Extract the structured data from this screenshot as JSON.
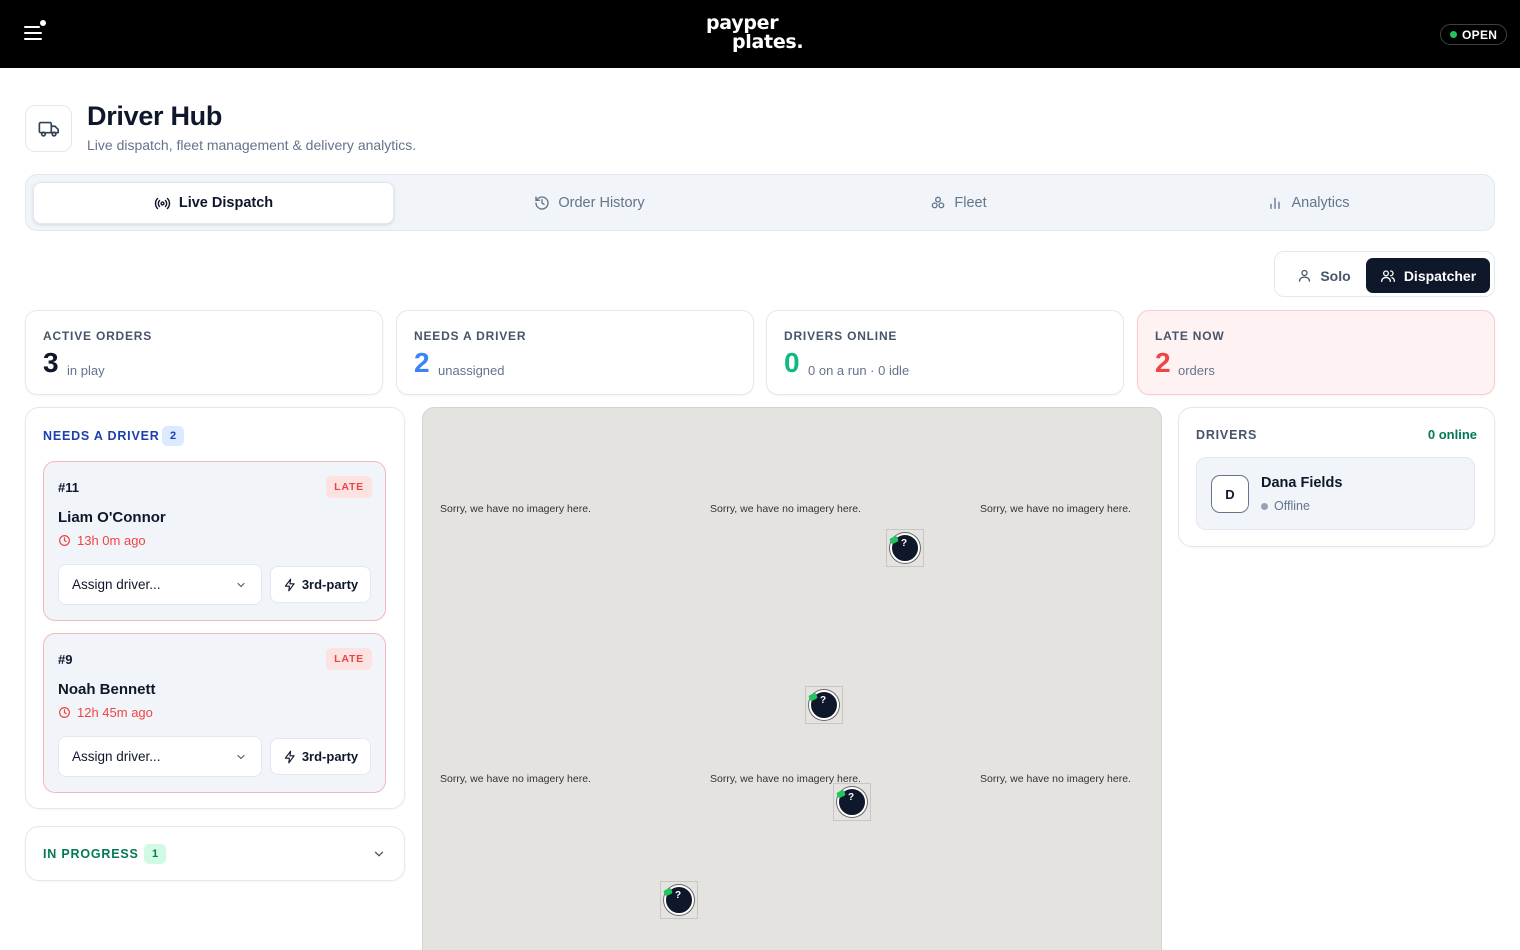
{
  "topbar": {
    "logo_line1": "payper",
    "logo_line2": "plates.",
    "status_label": "OPEN",
    "status_color": "#22c55e"
  },
  "header": {
    "title": "Driver Hub",
    "subtitle": "Live dispatch, fleet management & delivery analytics."
  },
  "tabs": [
    {
      "label": "Live Dispatch",
      "icon": "broadcast-icon",
      "active": true
    },
    {
      "label": "Order History",
      "icon": "history-icon",
      "active": false
    },
    {
      "label": "Fleet",
      "icon": "fleet-icon",
      "active": false
    },
    {
      "label": "Analytics",
      "icon": "bar-chart-icon",
      "active": false
    }
  ],
  "mode": {
    "solo_label": "Solo",
    "dispatcher_label": "Dispatcher",
    "selected": "Dispatcher"
  },
  "stats": [
    {
      "label": "ACTIVE ORDERS",
      "value": "3",
      "unit": "in play",
      "color": "#0f172a"
    },
    {
      "label": "NEEDS A DRIVER",
      "value": "2",
      "unit": "unassigned",
      "color": "#3b82f6"
    },
    {
      "label": "DRIVERS ONLINE",
      "value": "0",
      "unit": "0 on a run · 0 idle",
      "color": "#10b981"
    },
    {
      "label": "LATE NOW",
      "value": "2",
      "unit": "orders",
      "color": "#ef4444"
    }
  ],
  "needs_driver": {
    "title": "NEEDS A DRIVER",
    "count": "2",
    "orders": [
      {
        "id": "#11",
        "badge": "LATE",
        "name": "Liam O'Connor",
        "age": "13h 0m ago",
        "assign_placeholder": "Assign driver...",
        "third_party_label": "3rd-party"
      },
      {
        "id": "#9",
        "badge": "LATE",
        "name": "Noah Bennett",
        "age": "12h 45m ago",
        "assign_placeholder": "Assign driver...",
        "third_party_label": "3rd-party"
      }
    ]
  },
  "in_progress": {
    "title": "IN PROGRESS",
    "count": "1"
  },
  "map": {
    "no_imagery_text": "Sorry, we have no imagery here.",
    "marker_glyph": "?"
  },
  "drivers": {
    "title": "DRIVERS",
    "online_label": "0 online",
    "list": [
      {
        "initial": "D",
        "name": "Dana Fields",
        "status": "Offline"
      }
    ]
  },
  "colors": {
    "brand_dark": "#0f172a",
    "late_red": "#ef4444",
    "blue": "#3b82f6",
    "green": "#10b981",
    "in_progress_green": "#047857"
  }
}
